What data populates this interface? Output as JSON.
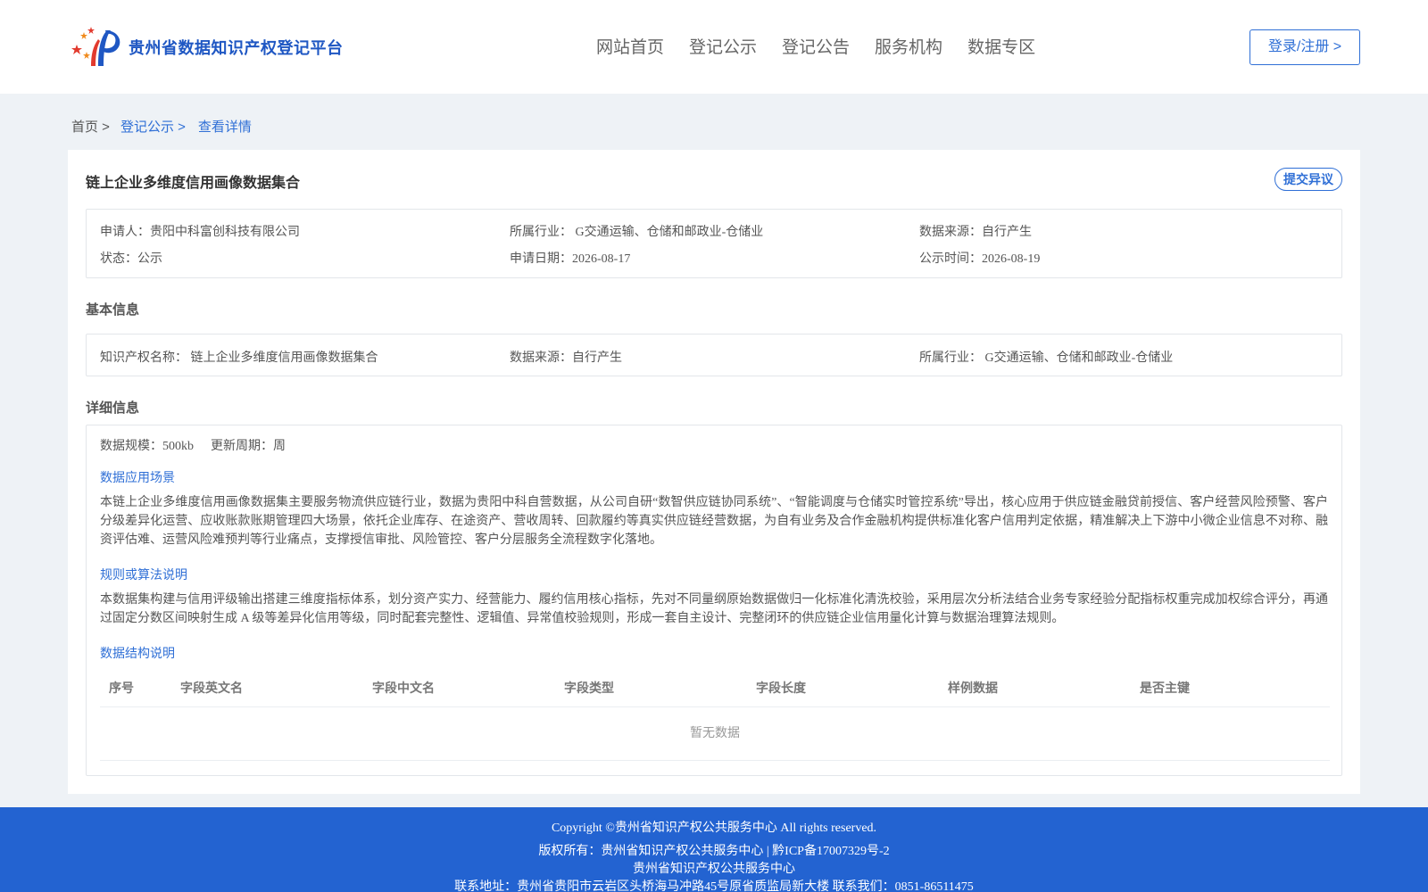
{
  "header": {
    "site_title": "贵州省数据知识产权登记平台",
    "nav": [
      "网站首页",
      "登记公示",
      "登记公告",
      "服务机构",
      "数据专区"
    ],
    "login_label": "登录/注册 >"
  },
  "breadcrumb": {
    "home": "首页 >",
    "parent": "登记公示 >",
    "current": "查看详情"
  },
  "detail": {
    "title": "链上企业多维度信用画像数据集合",
    "objection_label": "提交异议",
    "summary": {
      "applicant": "申请人：贵阳中科富创科技有限公司",
      "industry": "所属行业： G交通运输、仓储和邮政业-仓储业",
      "source": "数据来源：自行产生",
      "status": "状态：公示",
      "apply_date": "申请日期：2026-08-17",
      "publish_date": "公示时间：2026-08-19"
    },
    "basic": {
      "section_title": "基本信息",
      "ip_name": "知识产权名称： 链上企业多维度信用画像数据集合",
      "source": "数据来源：自行产生",
      "industry": "所属行业： G交通运输、仓储和邮政业-仓储业"
    },
    "info": {
      "section_title": "详细信息",
      "scale": "数据规模：500kb",
      "cycle": "更新周期：周",
      "scenario_title": "数据应用场景",
      "scenario_text": "本链上企业多维度信用画像数据集主要服务物流供应链行业，数据为贵阳中科自营数据，从公司自研“数智供应链协同系统”、“智能调度与仓储实时管控系统”导出，核心应用于供应链金融贷前授信、客户经营风险预警、客户分级差异化运营、应收账款账期管理四大场景，依托企业库存、在途资产、营收周转、回款履约等真实供应链经营数据，为自有业务及合作金融机构提供标准化客户信用判定依据，精准解决上下游中小微企业信息不对称、融资评估难、运营风险难预判等行业痛点，支撑授信审批、风险管控、客户分层服务全流程数字化落地。",
      "algorithm_title": "规则或算法说明",
      "algorithm_text": "本数据集构建与信用评级输出搭建三维度指标体系，划分资产实力、经营能力、履约信用核心指标，先对不同量纲原始数据做归一化标准化清洗校验，采用层次分析法结合业务专家经验分配指标权重完成加权综合评分，再通过固定分数区间映射生成 A 级等差异化信用等级，同时配套完整性、逻辑值、异常值校验规则，形成一套自主设计、完整闭环的供应链企业信用量化计算与数据治理算法规则。",
      "structure_title": "数据结构说明",
      "table_headers": [
        "序号",
        "字段英文名",
        "字段中文名",
        "字段类型",
        "字段长度",
        "样例数据",
        "是否主键"
      ],
      "empty_text": "暂无数据"
    }
  },
  "footer": {
    "copyright": "Copyright ©贵州省知识产权公共服务中心 All rights reserved.",
    "owner": "版权所有：贵州省知识产权公共服务中心 | 黔ICP备17007329号-2",
    "org": "贵州省知识产权公共服务中心",
    "address": "联系地址：贵州省贵阳市云岩区头桥海马冲路45号原省质监局新大楼 联系我们：0851-86511475"
  },
  "colors": {
    "brand": "#1f57c3",
    "link": "#2f6fd6",
    "footer_bg": "#2363d1"
  },
  "icons": {
    "logo": "platform-logo-icon"
  }
}
